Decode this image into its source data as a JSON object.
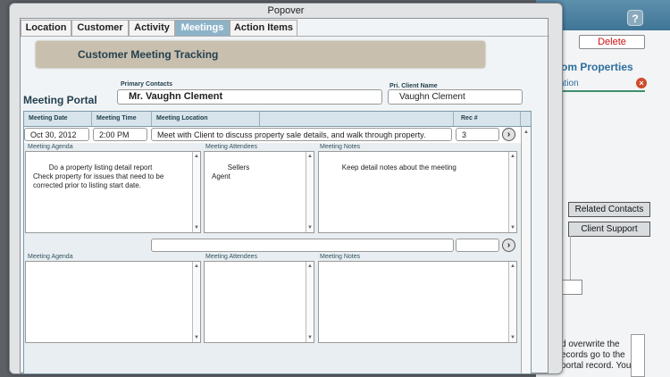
{
  "popover": {
    "title": "Popover"
  },
  "tabs": [
    {
      "label": "Location",
      "active": false
    },
    {
      "label": "Customer",
      "active": false
    },
    {
      "label": "Activity",
      "active": false
    },
    {
      "label": "Meetings",
      "active": true
    },
    {
      "label": "Action Items",
      "active": false
    }
  ],
  "banner": {
    "title": "Customer Meeting Tracking"
  },
  "header": {
    "primary_contacts_label": "Primary Contacts",
    "primary_contacts_value": "Mr. Vaughn Clement",
    "client_name_label": "Pri. Client Name",
    "client_name_value": "Vaughn Clement",
    "portal_title": "Meeting Portal"
  },
  "portal": {
    "columns": {
      "date": "Meeting Date",
      "time": "Meeting Time",
      "location": "Meeting Location",
      "rec": "Rec #"
    },
    "sub_labels": {
      "agenda": "Meeting Agenda",
      "attendees": "Meeting Attendees",
      "notes": "Meeting Notes"
    },
    "rows": [
      {
        "date": "Oct 30, 2012",
        "time": "2:00 PM",
        "location": "Meet with Client to discuss property sale details, and walk through property.",
        "rec": "3",
        "agenda": "Do a property listing detail report\nCheck property for issues that need to be\ncorrected prior to listing start date.",
        "attendees": "Sellers\nAgent",
        "notes": "Keep detail notes about the meeting"
      },
      {
        "date": "",
        "time": "",
        "location": "",
        "rec": "",
        "agenda": "",
        "attendees": "",
        "notes": ""
      }
    ]
  },
  "background_app": {
    "help_label": "?",
    "delete_label": "Delete",
    "heading": "tom Properties",
    "subheading": "ation",
    "close_icon": "×",
    "related_contacts_label": "Related Contacts",
    "client_support_label": "Client Support",
    "side_text": "d overwrite the\necords go to the\nportal record. You"
  },
  "colors": {
    "accent": "#8db3c9",
    "brand": "#3f7596",
    "delete": "#cc1111"
  }
}
